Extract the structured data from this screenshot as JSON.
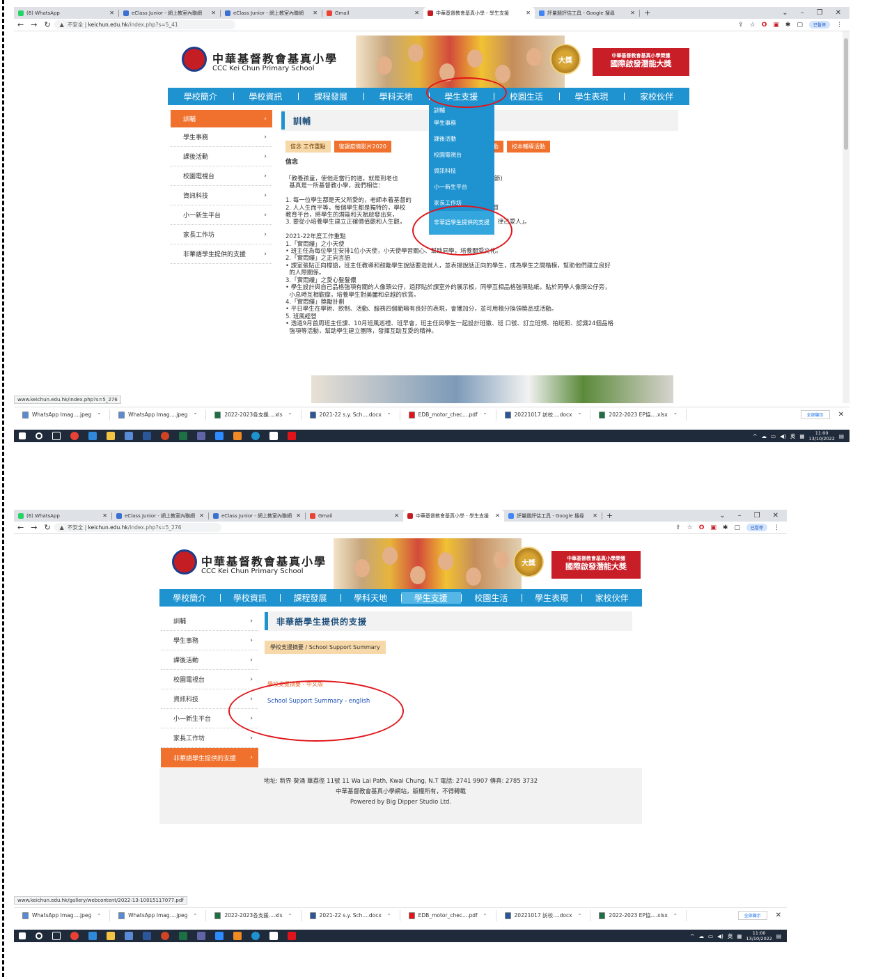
{
  "shot1": {
    "tabs": [
      {
        "label": "(6) WhatsApp",
        "color": "#25d366"
      },
      {
        "label": "eClass Junior - 網上教室內聯網",
        "color": "#3b6fd1"
      },
      {
        "label": "eClass Junior - 網上教室內聯網",
        "color": "#3b6fd1"
      },
      {
        "label": "Gmail",
        "color": "#ea4335"
      },
      {
        "label": "中華基督教會基真小學 - 學生支援",
        "color": "#c41d24"
      },
      {
        "label": "評量題評估工具 - Google 搜尋",
        "color": "#4285f4"
      }
    ],
    "url_warning": "不安全",
    "url_host": "keichun.edu.hk",
    "url_path": "/index.php?s=5_41",
    "status_url": "www.keichun.edu.hk/index.php?s=5_276",
    "section_title": "訓輔",
    "subtabs": [
      "信念 工作重點",
      "復課疫情影片2020",
      "生日活動",
      "校本輔導活動"
    ],
    "body_heading": "信念",
    "body_text": "「教養孩童，使他走當行的道，就是到老也                                          22章6節)\n  基真是一所基督教小學，我們相信：\n\n1. 每一位學生都是天父所愛的，老師本着基督的\n2. 人人生而平等，每個學生都是獨特的，學校                                     一個優質\n教育平台，將學生的潛能和天賦啟發出來，\n3. 要從小培養學生建立正確價值觀和人生觀，                           求「踐行真理，律己愛人」。\n\n2021-22年度工作重點\n1.「實悶縷」之小天使\n• 班主任為每位學生安排1位小天使，小天使學習關心、幫助同學，培養關愛文化。\n2.「實悶縷」之正向言語\n• 課室張貼正向標語，班主任教導和鼓勵學生說話要造就人，並表揚說話正向的學生，成為學生之間楷模，幫助他們建立良好\n  的人際關係。\n3.「實悶縷」之愛心髮髮儂\n• 學生設計與自己品格強項有關的人像頭公仔，過膠貼於課室外的展示板，同學互相品格強項貼紙，貼於同學人像頭公仔旁，\n  小息時互相觀摩，培養學生對美麗和卓越的欣賞。\n4.「實悶縷」獎勵計劃\n• 平日學生在學術、飲制、活動、服務四個範疇有良好的表現，會獲加分，並可用積分換領獎品或活動。\n5. 班風經營\n• 透過9月首周班主任課、10月班風巡禮、班早會，班主任與學生一起設計班徽、班 口號、訂立班規、拍班照、認識24個品格\n  強項等活動，幫助學生建立團隊，發揮互助互愛的精神。",
    "dropdown": [
      "訓輔",
      "學生事務",
      "課後活動",
      "校園電視台",
      "資訊科技",
      "小一新生平台",
      "家長工作坊",
      "非華語學生提供的支援"
    ]
  },
  "shot2": {
    "tabs": [
      {
        "label": "(6) WhatsApp",
        "color": "#25d366"
      },
      {
        "label": "eClass Junior - 網上教室內聯網",
        "color": "#3b6fd1"
      },
      {
        "label": "eClass Junior - 網上教室內聯網",
        "color": "#3b6fd1"
      },
      {
        "label": "Gmail",
        "color": "#ea4335"
      },
      {
        "label": "中華基督教會基真小學 - 學生支援",
        "color": "#c41d24"
      },
      {
        "label": "評量題評估工具 - Google 搜尋",
        "color": "#4285f4"
      }
    ],
    "url_warning": "不安全",
    "url_host": "keichun.edu.hk",
    "url_path": "/index.php?s=5_276",
    "status_url": "www.keichun.edu.hk/gallery/webcontent/2022-13-10015117077.pdf",
    "section_title": "非華語學生提供的支援",
    "summary_button": "學校支援摘要 / School Support Summary",
    "link_cn": "學校支援摘要 - 中文版",
    "link_en": "School Support Summary - english",
    "footer_line1": "地址: 新界 葵涌 華荔徑 11號    11 Wa Lai Path, Kwai Chung, N.T    電話: 2741 9907    傳真: 2785 3732",
    "footer_line2": "中華基督教會基真小學網站，版權所有，不得轉載",
    "footer_line3": "Powered by Big Dipper Studio Ltd."
  },
  "common": {
    "school_cn": "中華基督教會基真小學",
    "school_en": "CCC Kei Chun Primary School",
    "award_badge": "大獎",
    "award_small": "中華基督教會基真小學榮獲",
    "award_big": "國際啟發潛能大獎",
    "nav": [
      "學校簡介",
      "學校資訊",
      "課程發展",
      "學科天地",
      "學生支援",
      "校園生活",
      "學生表現",
      "家校伙伴"
    ],
    "side": [
      "訓輔",
      "學生事務",
      "課後活動",
      "校園電視台",
      "資訊科技",
      "小一新生平台",
      "家長工作坊",
      "非華語學生提供的支援"
    ],
    "profile_label": "已暫停",
    "downloads": [
      {
        "label": "WhatsApp Imag....jpeg",
        "color": "#5a8ad6"
      },
      {
        "label": "WhatsApp Imag....jpeg",
        "color": "#5a8ad6"
      },
      {
        "label": "2022-2023各支援....xls",
        "color": "#1d7044"
      },
      {
        "label": "2021-22 s.y. Sch....docx",
        "color": "#2b579a"
      },
      {
        "label": "EDB_motor_chec....pdf",
        "color": "#e0151b"
      },
      {
        "label": "20221017 訪校....docx",
        "color": "#2b579a"
      },
      {
        "label": "2022-2023 EP協....xlsx",
        "color": "#1d7044"
      }
    ],
    "show_all": "全部顯示",
    "tray_lang": "英",
    "time": "11:00",
    "date": "13/10/2022"
  }
}
